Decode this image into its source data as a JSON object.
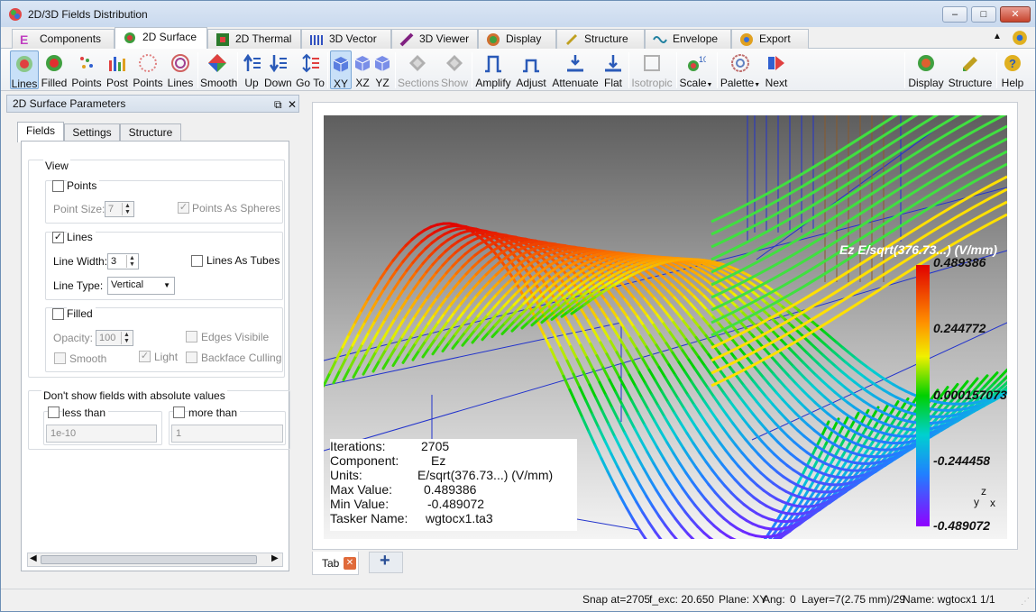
{
  "window": {
    "title": "2D/3D Fields Distribution",
    "min": "–",
    "max": "□",
    "close": "✕"
  },
  "tabs": [
    {
      "label": "Components",
      "icon": "components-icon",
      "color": "#c040c0"
    },
    {
      "label": "2D Surface",
      "icon": "surface-icon",
      "color": "#d04040"
    },
    {
      "label": "2D Thermal",
      "icon": "thermal-icon",
      "color": "#20a040"
    },
    {
      "label": "3D Vector",
      "icon": "vector-icon",
      "color": "#3050c0"
    },
    {
      "label": "3D Viewer",
      "icon": "viewer-icon",
      "color": "#802080"
    },
    {
      "label": "Display",
      "icon": "display-icon",
      "color": "#d08020"
    },
    {
      "label": "Structure",
      "icon": "structure-icon",
      "color": "#c0a020"
    },
    {
      "label": "Envelope",
      "icon": "envelope-icon",
      "color": "#2080a0"
    },
    {
      "label": "Export",
      "icon": "export-icon",
      "color": "#e0a020"
    }
  ],
  "tab_right": {
    "up": "▲"
  },
  "toolbar": {
    "lines": "Lines",
    "filled": "Filled",
    "points": "Points",
    "post": "Post",
    "points2": "Points",
    "lines2": "Lines",
    "smooth": "Smooth",
    "up": "Up",
    "down": "Down",
    "goto": "Go To",
    "xy": "XY",
    "xz": "XZ",
    "yz": "YZ",
    "sections": "Sections",
    "show": "Show",
    "amplify": "Amplify",
    "adjust": "Adjust",
    "attenuate": "Attenuate",
    "flat": "Flat",
    "isotropic": "Isotropic",
    "scale": "Scale",
    "palette": "Palette",
    "next": "Next",
    "display": "Display",
    "structure": "Structure",
    "help": "Help"
  },
  "panel": {
    "title": "2D Surface Parameters",
    "float": "⧉",
    "close": "✕",
    "tabs": [
      "Fields",
      "Settings",
      "Structure"
    ],
    "view_label": "View",
    "points_label": "Points",
    "point_size_label": "Point Size:",
    "point_size_value": "7",
    "points_as_spheres": "Points As Spheres",
    "lines_label": "Lines",
    "line_width_label": "Line Width:",
    "line_width_value": "3",
    "lines_as_tubes": "Lines As Tubes",
    "line_type_label": "Line Type:",
    "line_type_value": "Vertical",
    "filled_label": "Filled",
    "opacity_label": "Opacity:",
    "opacity_value": "100",
    "edges_visible": "Edges Visibile",
    "smooth_label": "Smooth",
    "light_label": "Light",
    "backface": "Backface Culling",
    "abs_label": "Don't show fields with absolute values",
    "less_than": "less than",
    "more_than": "more than",
    "less_value": "1e-10",
    "more_value": "1",
    "check": "✓"
  },
  "info": {
    "iterations_label": "Iterations:",
    "iterations": "2705",
    "component_label": "Component:",
    "component": "Ez",
    "units_label": "Units:",
    "units": "E/sqrt(376.73...) (V/mm)",
    "max_label": "Max Value:",
    "max": "0.489386",
    "min_label": "Min Value:",
    "min": "-0.489072",
    "tasker_label": "Tasker Name:",
    "tasker": "wgtocx1.ta3"
  },
  "colorbar": {
    "title": "Ez E/sqrt(376.73...) (V/mm)",
    "labels": [
      "0.489386",
      "0.244772",
      "0.000157073",
      "-0.244458",
      "-0.489072"
    ]
  },
  "axes": {
    "z": "z",
    "y": "y",
    "x": "x"
  },
  "bottom": {
    "tab": "Tab",
    "close": "✕",
    "add": "+"
  },
  "status": {
    "snap": "Snap at=2705",
    "fexc": "f_exc: 20.650",
    "plane": "Plane: XY",
    "ang": "Ang:",
    "ang_val": "0",
    "layer": "Layer=7(2.75 mm)/29",
    "name": "Name: wgtocx1 1/1"
  }
}
